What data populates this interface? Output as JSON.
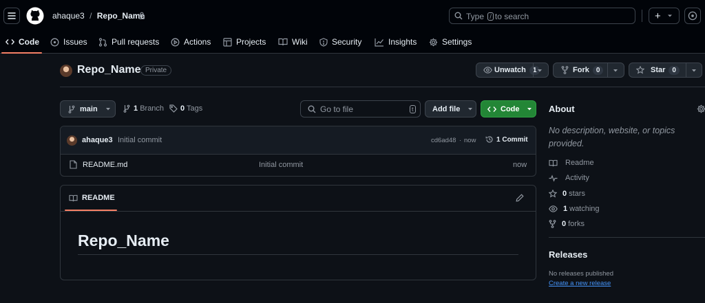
{
  "header": {
    "owner": "ahaque3",
    "separator": "/",
    "repo": "Repo_Name",
    "search": {
      "type_label": "Type",
      "key": "/",
      "rest_label": "to search"
    },
    "plus_label": "+"
  },
  "nav": {
    "tabs": [
      {
        "label": "Code",
        "icon": "code-icon",
        "active": true
      },
      {
        "label": "Issues",
        "icon": "issue-opened-icon"
      },
      {
        "label": "Pull requests",
        "icon": "git-pull-request-icon"
      },
      {
        "label": "Actions",
        "icon": "play-icon"
      },
      {
        "label": "Projects",
        "icon": "table-icon"
      },
      {
        "label": "Wiki",
        "icon": "book-icon"
      },
      {
        "label": "Security",
        "icon": "shield-icon"
      },
      {
        "label": "Insights",
        "icon": "graph-icon"
      },
      {
        "label": "Settings",
        "icon": "gear-icon"
      }
    ]
  },
  "repo_header": {
    "name": "Repo_Name",
    "visibility": "Private",
    "watch": {
      "label": "Unwatch",
      "count": "1"
    },
    "fork": {
      "label": "Fork",
      "count": "0"
    },
    "star": {
      "label": "Star",
      "count": "0"
    }
  },
  "toolbar": {
    "branch": "main",
    "branches_count": "1",
    "branches_label": "Branch",
    "tags_count": "0",
    "tags_label": "Tags",
    "goto_placeholder": "Go to file",
    "goto_key": "t",
    "add_file": "Add file",
    "code": "Code"
  },
  "commit": {
    "author": "ahaque3",
    "message": "Initial commit",
    "hash": "cd6ad48",
    "dot": "·",
    "time": "now",
    "commits_count": "1",
    "commits_label": "Commit"
  },
  "files": [
    {
      "name": "README.md",
      "message": "Initial commit",
      "time": "now",
      "icon": "file-icon"
    }
  ],
  "readme": {
    "tab_label": "README",
    "heading": "Repo_Name"
  },
  "about": {
    "title": "About",
    "description": "No description, website, or topics provided.",
    "items": [
      {
        "icon": "book-icon",
        "strong": "",
        "label": "Readme"
      },
      {
        "icon": "pulse-icon",
        "strong": "",
        "label": "Activity"
      },
      {
        "icon": "star-icon",
        "strong": "0",
        "label": "stars"
      },
      {
        "icon": "eye-icon",
        "strong": "1",
        "label": "watching"
      },
      {
        "icon": "repo-forked-icon",
        "strong": "0",
        "label": "forks"
      }
    ]
  },
  "releases": {
    "title": "Releases",
    "empty": "No releases published",
    "create_link": "Create a new release"
  },
  "colors": {
    "background": "#0d1117",
    "header_bg": "#010409",
    "border": "#30363d",
    "accent_underline": "#f78166",
    "code_button": "#238636",
    "link": "#4493f8"
  }
}
